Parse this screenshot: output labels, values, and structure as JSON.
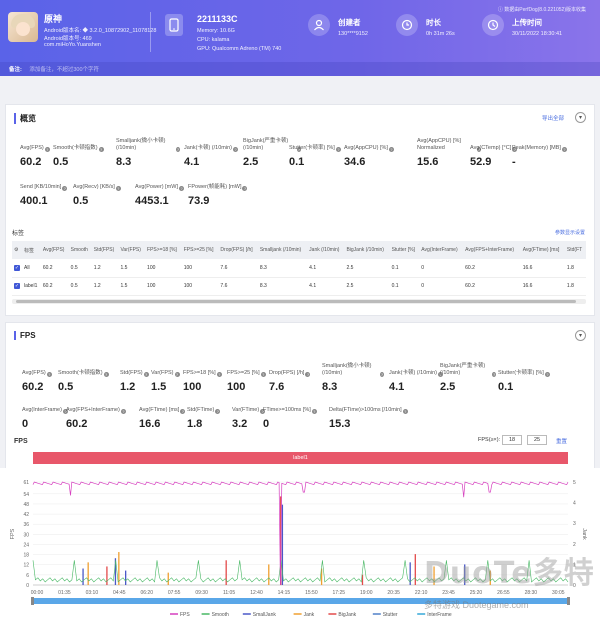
{
  "header": {
    "app_name": "原神",
    "app_lines": [
      "Android版本名: ◆ 3.2.0_10872902_11078128",
      "Android版本号: 469",
      "com.miHoYo.Yuanshen"
    ],
    "device_name": "2211133C",
    "device_lines": [
      "Memory: 10.6G",
      "CPU: kalama",
      "GPU: Qualcomm Adreno (TM) 740"
    ],
    "creator_label": "创建者",
    "creator_value": "130****9152",
    "duration_label": "时长",
    "duration_value": "0h 31m 26s",
    "upload_label": "上传时间",
    "upload_value": "30/11/2022 18:30:41",
    "source": "数据由PerfDog(8.0.221052)版本收集",
    "note_label": "备注:",
    "note_placeholder": "添加备注，不超过300个字符"
  },
  "overview": {
    "title": "概览",
    "export": "导出全部",
    "metrics_row1": [
      {
        "label": "Avg(FPS)",
        "value": "60.2"
      },
      {
        "label": "Smooth(卡顿指数)",
        "value": "0.5"
      },
      {
        "label": "Smalljank(微小卡顿) (/10min)",
        "value": "8.3"
      },
      {
        "label": "Jank(卡顿) (/10min)",
        "value": "4.1"
      },
      {
        "label": "BigJank(严重卡顿) (/10min)",
        "value": "2.5"
      },
      {
        "label": "Stutter(卡顿率) [%]",
        "value": "0.1"
      },
      {
        "label": "Avg(AppCPU) [%]",
        "value": "34.6"
      },
      {
        "label": "Avg(AppCPU) [%] Normalized",
        "value": "15.6"
      },
      {
        "label": "Avg(CTemp) [°C]",
        "value": "52.9"
      },
      {
        "label": "Peak(Memory) [MB]",
        "value": "-"
      }
    ],
    "metrics_row2": [
      {
        "label": "Send [KB/10min]",
        "value": "400.1"
      },
      {
        "label": "Avg(Recv) [KB/s]",
        "value": "0.5"
      },
      {
        "label": "Avg(Power) [mW]",
        "value": "4453.1"
      },
      {
        "label": "FPower(帧能耗) [mW]",
        "value": "73.9"
      }
    ],
    "tag_section": "标签",
    "show_params": "参数显示设置",
    "table": {
      "headers": [
        "标签",
        "Avg(FPS)",
        "Smooth",
        "Std(FPS)",
        "Var(FPS)",
        "FPS>=18 [%]",
        "FPS>=25 [%]",
        "Drop(FPS) [/h]",
        "Smalljank (/10min)",
        "Jank (/10min)",
        "BigJank (/10min)",
        "Stutter [%]",
        "Avg(InterFrame)",
        "Avg(FPS+InterFrame)",
        "Avg(FTime) [ms]",
        "Std(FT"
      ],
      "rows": [
        [
          "All",
          "60.2",
          "0.5",
          "1.2",
          "1.5",
          "100",
          "100",
          "7.6",
          "8.3",
          "4.1",
          "2.5",
          "0.1",
          "0",
          "60.2",
          "16.6",
          "1.8"
        ],
        [
          "label1",
          "60.2",
          "0.5",
          "1.2",
          "1.5",
          "100",
          "100",
          "7.6",
          "8.3",
          "4.1",
          "2.5",
          "0.1",
          "0",
          "60.2",
          "16.6",
          "1.8"
        ]
      ]
    }
  },
  "fps_panel": {
    "title": "FPS",
    "metrics_row1": [
      {
        "label": "Avg(FPS)",
        "value": "60.2"
      },
      {
        "label": "Smooth(卡顿指数)",
        "value": "0.5"
      },
      {
        "label": "Std(FPS)",
        "value": "1.2"
      },
      {
        "label": "Var(FPS)",
        "value": "1.5"
      },
      {
        "label": "FPS>=18 [%]",
        "value": "100"
      },
      {
        "label": "FPS>=25 [%]",
        "value": "100"
      },
      {
        "label": "Drop(FPS) [/h]",
        "value": "7.6"
      },
      {
        "label": "Smalljank(微小卡顿) (/10min)",
        "value": "8.3"
      },
      {
        "label": "Jank(卡顿) (/10min)",
        "value": "4.1"
      },
      {
        "label": "BigJank(严重卡顿) (/10min)",
        "value": "2.5"
      },
      {
        "label": "Stutter(卡顿率) [%]",
        "value": "0.1"
      }
    ],
    "metrics_row2": [
      {
        "label": "Avg(InterFrame)",
        "value": "0"
      },
      {
        "label": "Avg(FPS+InterFrame)",
        "value": "60.2"
      },
      {
        "label": "Avg(FTime) [ms]",
        "value": "16.6"
      },
      {
        "label": "Std(FTime)",
        "value": "1.8"
      },
      {
        "label": "Var(FTime)",
        "value": "3.2"
      },
      {
        "label": "FTime>=100ms [%]",
        "value": "0"
      },
      {
        "label": "Delta(FTime)>100ms [/10min]",
        "value": "15.3"
      }
    ],
    "chart_label": "FPS",
    "range_label": "FPS(≥×):",
    "range_a": "18",
    "range_b": "25",
    "reset": "重置",
    "lane_label": "label1"
  },
  "chart_data": {
    "type": "line",
    "ylabel": "FPS",
    "ylabel2": "Jank",
    "yticks": [
      "0",
      "6",
      "12",
      "18",
      "24",
      "30",
      "36",
      "42",
      "48",
      "54",
      "61"
    ],
    "y2ticks": [
      "0",
      "1",
      "2",
      "3",
      "4",
      "5"
    ],
    "ylim": [
      0,
      61
    ],
    "y2lim": [
      0,
      5
    ],
    "categories": [
      "00:00",
      "01:35",
      "03:10",
      "04:45",
      "06:20",
      "07:55",
      "09:30",
      "11:05",
      "12:40",
      "14:15",
      "15:50",
      "17:25",
      "19:00",
      "20:35",
      "22:10",
      "23:45",
      "25:20",
      "26:55",
      "28:30",
      "30:05"
    ],
    "series": [
      {
        "name": "FPS",
        "color": "#d63fbf",
        "baseline": 60.2,
        "dips": [
          [
            14.5,
            0
          ],
          [
            2.2,
            53
          ],
          [
            25.3,
            52
          ],
          [
            26.8,
            55
          ],
          [
            15.9,
            55
          ]
        ]
      },
      {
        "name": "Smooth",
        "color": "#48b864"
      },
      {
        "name": "SmallJank",
        "color": "#4a58c8"
      },
      {
        "name": "Jank",
        "color": "#f0a030"
      },
      {
        "name": "BigJank",
        "color": "#e34a4a"
      },
      {
        "name": "Stutter",
        "color": "#5080c8"
      },
      {
        "name": "InterFrame",
        "color": "#36a8d8"
      }
    ],
    "events": [
      {
        "t": 2.9,
        "type": "SmallJank",
        "h": 0.8
      },
      {
        "t": 3.2,
        "type": "Jank",
        "h": 1.1
      },
      {
        "t": 4.3,
        "type": "BigJank",
        "h": 0.9
      },
      {
        "t": 4.8,
        "type": "SmallJank",
        "h": 1.3
      },
      {
        "t": 5.0,
        "type": "Jank",
        "h": 1.6
      },
      {
        "t": 5.4,
        "type": "SmallJank",
        "h": 0.7
      },
      {
        "t": 7.9,
        "type": "Jank",
        "h": 0.6
      },
      {
        "t": 11.3,
        "type": "BigJank",
        "h": 1.2
      },
      {
        "t": 13.8,
        "type": "Jank",
        "h": 1.0
      },
      {
        "t": 14.5,
        "type": "BigJank",
        "h": 4.3
      },
      {
        "t": 14.6,
        "type": "SmallJank",
        "h": 3.9
      },
      {
        "t": 16.9,
        "type": "Jank",
        "h": 0.8
      },
      {
        "t": 19.3,
        "type": "BigJank",
        "h": 0.5
      },
      {
        "t": 22.1,
        "type": "SmallJank",
        "h": 1.1
      },
      {
        "t": 22.4,
        "type": "BigJank",
        "h": 1.5
      },
      {
        "t": 23.5,
        "type": "Jank",
        "h": 0.9
      },
      {
        "t": 25.3,
        "type": "SmallJank",
        "h": 1.0
      },
      {
        "t": 26.8,
        "type": "Jank",
        "h": 0.7
      }
    ],
    "xlim": [
      0,
      31.4
    ],
    "legend_position": "bottom"
  },
  "watermark": {
    "main": "DuoTe多特",
    "sub": "多特游戏 Duotegame.com"
  }
}
